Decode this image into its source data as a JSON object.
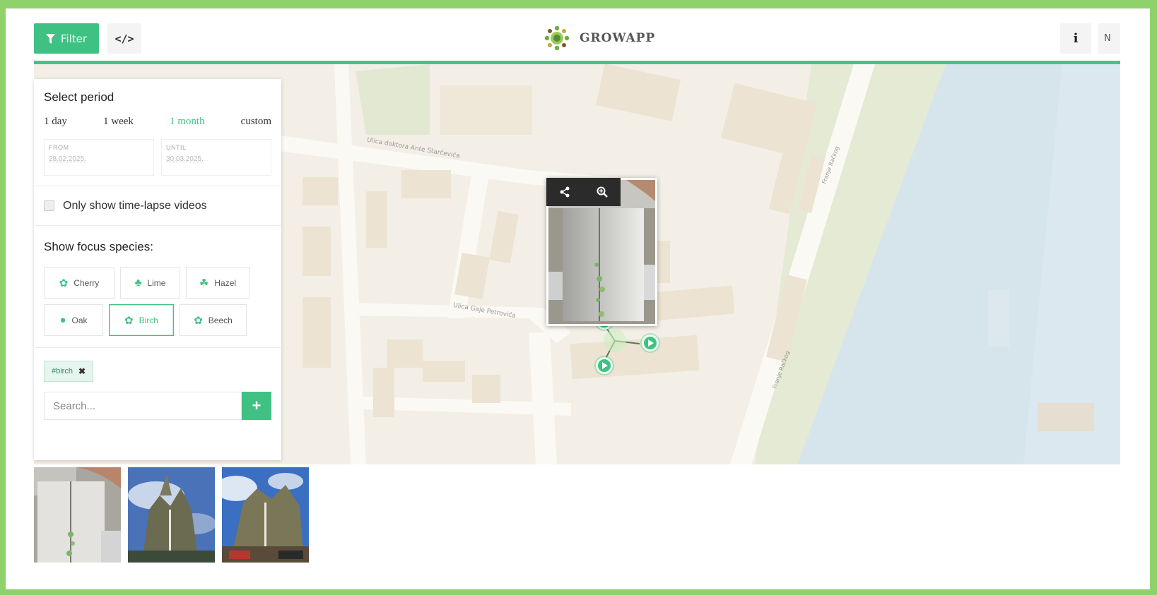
{
  "header": {
    "filter_label": "Filter",
    "code_label": "</>",
    "brand": "GROWAPP",
    "info_label": "i",
    "lang_label": "N"
  },
  "panel": {
    "period_title": "Select period",
    "periods": [
      "1 day",
      "1 week",
      "1 month",
      "custom"
    ],
    "active_period": "1 month",
    "from_label": "FROM",
    "from_value": "28.02.2025.",
    "until_label": "UNTIL",
    "until_value": "30.03.2025.",
    "timelapse_label": "Only show time-lapse videos",
    "timelapse_checked": false,
    "species_title": "Show focus species:",
    "species": [
      {
        "label": "Cherry",
        "icon": "leaf-icon",
        "active": false
      },
      {
        "label": "Lime",
        "icon": "lime-leaf-icon",
        "active": false
      },
      {
        "label": "Hazel",
        "icon": "hazel-leaf-icon",
        "active": false
      },
      {
        "label": "Oak",
        "icon": "oak-leaf-icon",
        "active": false
      },
      {
        "label": "Birch",
        "icon": "birch-leaf-icon",
        "active": true
      },
      {
        "label": "Beech",
        "icon": "beech-leaf-icon",
        "active": false
      }
    ],
    "tag_label": "#birch",
    "search_placeholder": "Search...",
    "add_label": "+"
  },
  "map": {
    "street_labels": [
      "Ulica doktora Ante Starčevića",
      "Ulica Gaje Petrovića",
      "Franje Račkog",
      "Franje Račkog"
    ]
  },
  "colors": {
    "accent": "#3fc184",
    "frame": "#8fd16a",
    "water": "#d8e6ee",
    "park": "#e6ecd8",
    "road": "#fbf9f5",
    "building": "#efe5d5"
  }
}
